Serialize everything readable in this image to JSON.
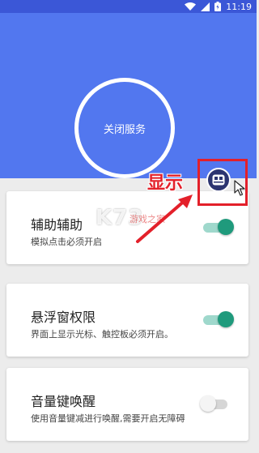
{
  "status_bar": {
    "time": "11:19",
    "icons": [
      "wifi-icon",
      "signal-icon",
      "battery-charging-icon"
    ]
  },
  "header": {
    "service_button_label": "关闭服务",
    "accent_color": "#5277ef"
  },
  "annotation": {
    "label": "显示",
    "color": "#e3202a"
  },
  "watermark": {
    "text": "K73",
    "sub": "游戏之家"
  },
  "settings": [
    {
      "title": "辅助辅助",
      "desc": "模拟点击必须开启",
      "enabled": true
    },
    {
      "title": "悬浮窗权限",
      "desc": "界面上显示光标、触控板必须开启。",
      "enabled": true
    },
    {
      "title": "音量键唤醒",
      "desc": "使用音量键减进行唤醒,需要开启无障碍",
      "enabled": false
    }
  ],
  "colors": {
    "toggle_on": "#1f9a7c",
    "toggle_track_on": "#9fd8cc",
    "toggle_off": "#d6d6d6"
  }
}
